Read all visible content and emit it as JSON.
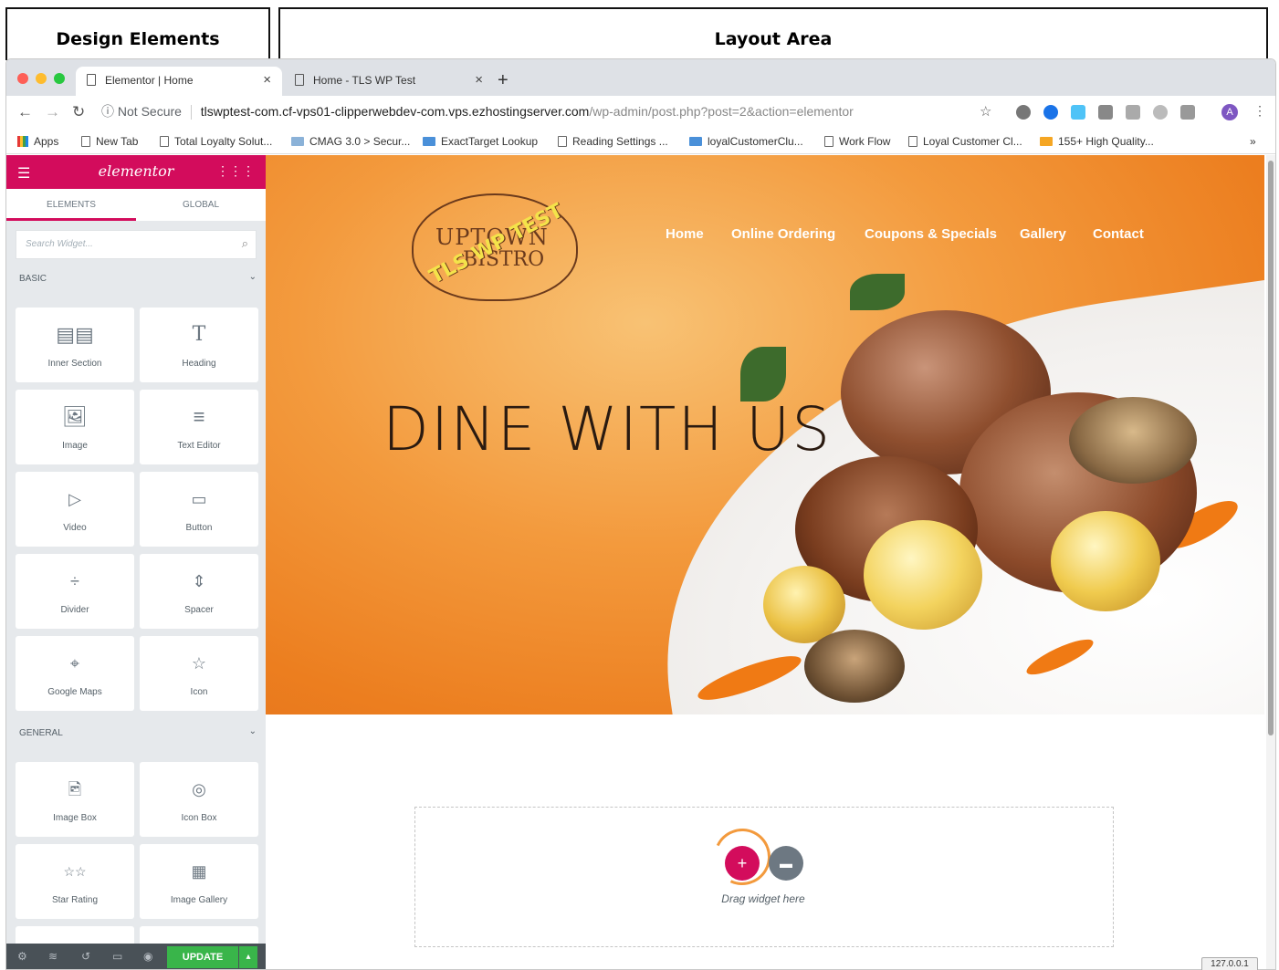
{
  "annotations": {
    "design_elements": "Design Elements",
    "layout_area": "Layout Area"
  },
  "browser": {
    "tabs": [
      {
        "title": "Elementor | Home",
        "active": true
      },
      {
        "title": "Home - TLS WP Test",
        "active": false
      }
    ],
    "new_tab": "+",
    "close": "×",
    "security": "Not Secure",
    "url_domain": "tlswptest-com.cf-vps01-clipperwebdev-com.vps.ezhostingserver.com",
    "url_path": "/wp-admin/post.php?post=2&action=elementor",
    "avatar_letter": "A",
    "bookmarks": [
      "Apps",
      "New Tab",
      "Total Loyalty Solut...",
      "CMAG 3.0 > Secur...",
      "ExactTarget Lookup",
      "Reading Settings ...",
      "loyalCustomerClu...",
      "Work Flow",
      "Loyal Customer Cl...",
      "155+ High Quality..."
    ],
    "bookmarks_more": "»"
  },
  "panel": {
    "brand": "elementor",
    "tabs": [
      "ELEMENTS",
      "GLOBAL"
    ],
    "search_placeholder": "Search Widget...",
    "categories": {
      "basic": "BASIC",
      "general": "GENERAL"
    },
    "widgets_basic": [
      "Inner Section",
      "Heading",
      "Image",
      "Text Editor",
      "Video",
      "Button",
      "Divider",
      "Spacer",
      "Google Maps",
      "Icon"
    ],
    "widgets_general": [
      "Image Box",
      "Icon Box",
      "Star Rating",
      "Image Gallery"
    ],
    "update": "UPDATE"
  },
  "site": {
    "logo_line1": "UPTOWN",
    "logo_line2": "BISTRO",
    "logo_stamp": "TLS WP TEST",
    "nav": [
      "Home",
      "Online Ordering",
      "Coupons & Specials",
      "Gallery",
      "Contact"
    ],
    "hero_title": "DINE WITH US",
    "drag_text": "Drag widget here"
  },
  "status": "127.0.0.1",
  "colors": {
    "brand": "#d30c5c",
    "update": "#39b54a",
    "hero": "#f39a3d"
  }
}
